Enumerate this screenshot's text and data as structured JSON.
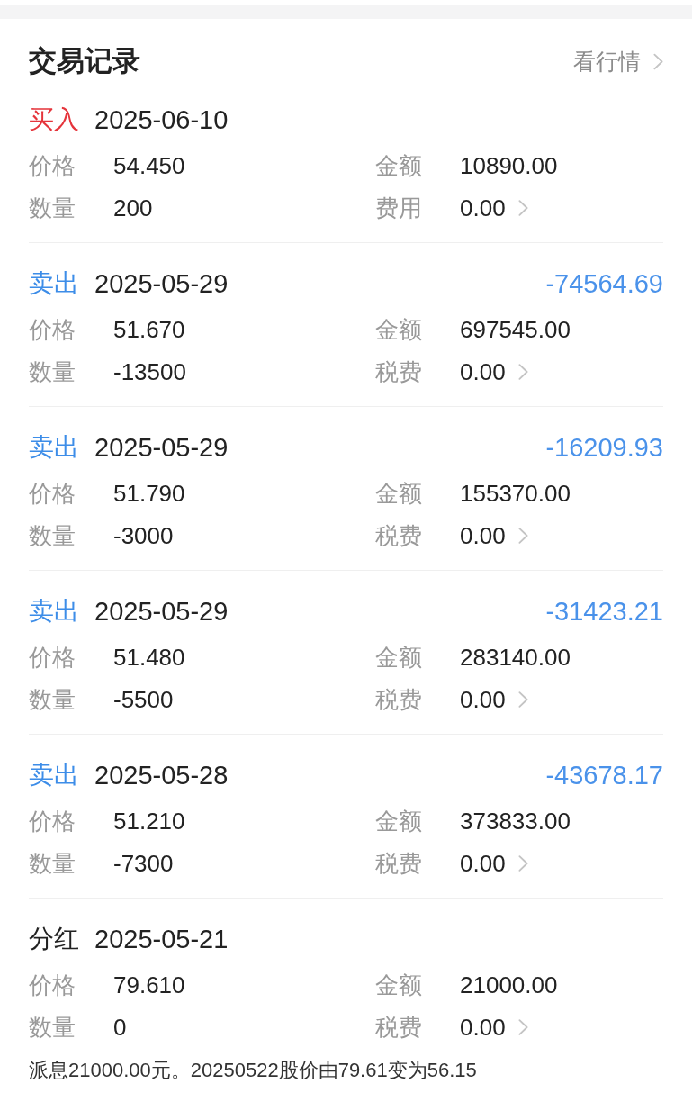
{
  "header": {
    "title": "交易记录",
    "link": "看行情"
  },
  "records": [
    {
      "kind": "buy",
      "type": "买入",
      "date": "2025-06-10",
      "fields": [
        {
          "label": "价格",
          "value": "54.450"
        },
        {
          "label": "金额",
          "value": "10890.00"
        },
        {
          "label": "数量",
          "value": "200"
        },
        {
          "label": "费用",
          "value": "0.00"
        }
      ]
    },
    {
      "kind": "sell",
      "type": "卖出",
      "date": "2025-05-29",
      "profit": "-74564.69",
      "fields": [
        {
          "label": "价格",
          "value": "51.670"
        },
        {
          "label": "金额",
          "value": "697545.00"
        },
        {
          "label": "数量",
          "value": "-13500"
        },
        {
          "label": "税费",
          "value": "0.00"
        }
      ]
    },
    {
      "kind": "sell",
      "type": "卖出",
      "date": "2025-05-29",
      "profit": "-16209.93",
      "fields": [
        {
          "label": "价格",
          "value": "51.790"
        },
        {
          "label": "金额",
          "value": "155370.00"
        },
        {
          "label": "数量",
          "value": "-3000"
        },
        {
          "label": "税费",
          "value": "0.00"
        }
      ]
    },
    {
      "kind": "sell",
      "type": "卖出",
      "date": "2025-05-29",
      "profit": "-31423.21",
      "fields": [
        {
          "label": "价格",
          "value": "51.480"
        },
        {
          "label": "金额",
          "value": "283140.00"
        },
        {
          "label": "数量",
          "value": "-5500"
        },
        {
          "label": "税费",
          "value": "0.00"
        }
      ]
    },
    {
      "kind": "sell",
      "type": "卖出",
      "date": "2025-05-28",
      "profit": "-43678.17",
      "fields": [
        {
          "label": "价格",
          "value": "51.210"
        },
        {
          "label": "金额",
          "value": "373833.00"
        },
        {
          "label": "数量",
          "value": "-7300"
        },
        {
          "label": "税费",
          "value": "0.00"
        }
      ]
    },
    {
      "kind": "dividend",
      "type": "分红",
      "date": "2025-05-21",
      "fields": [
        {
          "label": "价格",
          "value": "79.610"
        },
        {
          "label": "金额",
          "value": "21000.00"
        },
        {
          "label": "数量",
          "value": "0"
        },
        {
          "label": "税费",
          "value": "0.00"
        }
      ],
      "note": "派息21000.00元。20250522股价由79.61变为56.15"
    }
  ]
}
